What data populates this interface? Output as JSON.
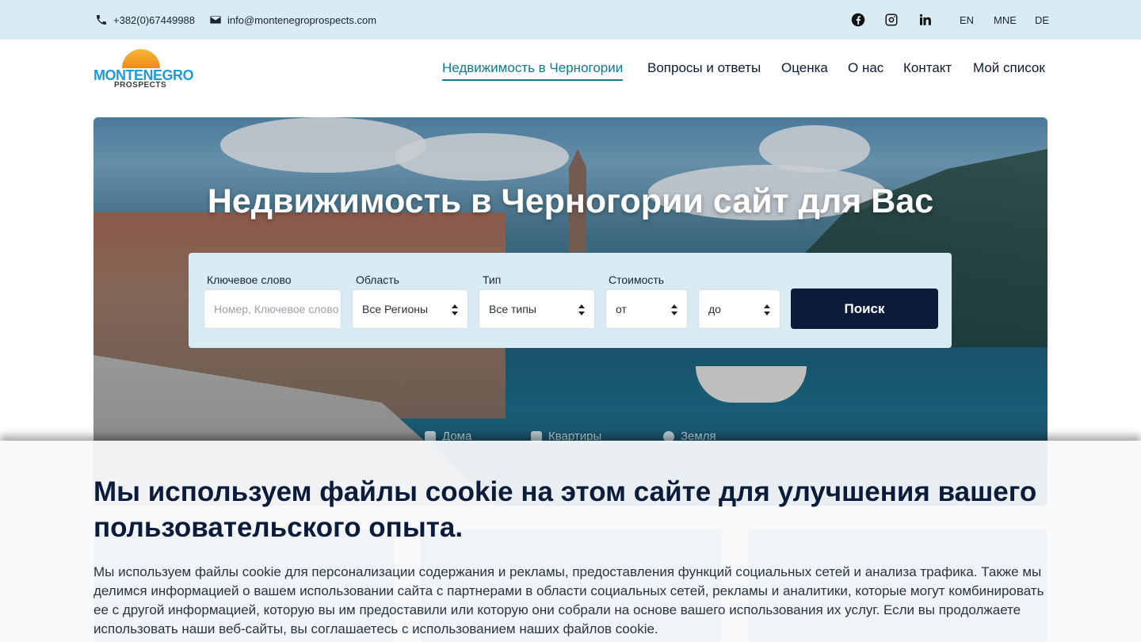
{
  "topbar": {
    "phone": "+382(0)67449988",
    "email": "info@montenegroprospects.com",
    "social": [
      "facebook-icon",
      "instagram-icon",
      "linkedin-icon"
    ],
    "languages": [
      "EN",
      "MNE",
      "DE"
    ]
  },
  "logo": {
    "line1": "MONTENEGRO",
    "line2": "PROSPECTS"
  },
  "nav": {
    "items": [
      {
        "label": "Недвижимость в Черногории",
        "active": true
      },
      {
        "label": "Вопросы и ответы",
        "active": false
      },
      {
        "label": "Оценка",
        "active": false
      },
      {
        "label": "О нас",
        "active": false
      },
      {
        "label": "Контакт",
        "active": false
      },
      {
        "label": "Мой список",
        "active": false
      }
    ]
  },
  "hero": {
    "title": "Недвижимость в Черногории сайт для Вас"
  },
  "search": {
    "keyword_label": "Ключевое слово",
    "keyword_placeholder": "Номер, Ключевое слово",
    "region_label": "Область",
    "region_value": "Все Регионы",
    "type_label": "Тип",
    "type_value": "Все типы",
    "price_label": "Стоимость",
    "price_from": "от",
    "price_to": "до",
    "button": "Поиск"
  },
  "categories": [
    "Дома",
    "Квартиры",
    "Земля"
  ],
  "cookie": {
    "title": "Мы используем файлы cookie на этом сайте для улучшения вашего пользовательского опыта.",
    "text": "Мы используем файлы cookie для персонализации содержания и рекламы, предоставления функций социальных сетей и анализа трафика. Также мы делимся информацией о вашем использовании сайта с партнерами в области социальных сетей, рекламы и аналитики, которые могут комбинировать ее с другой информацией, которую вы им предоставили или которую они собрали на основе вашего использования их услуг. Если вы продолжаете использовать наши веб-сайты, вы соглашаетесь с использованием наших файлов cookie."
  },
  "colors": {
    "topbar_bg": "#d9ebf3",
    "accent": "#0f7a93",
    "button_bg": "#0b1b3a",
    "logo_blue": "#1e9bd7",
    "logo_sun": "#f7b733"
  }
}
